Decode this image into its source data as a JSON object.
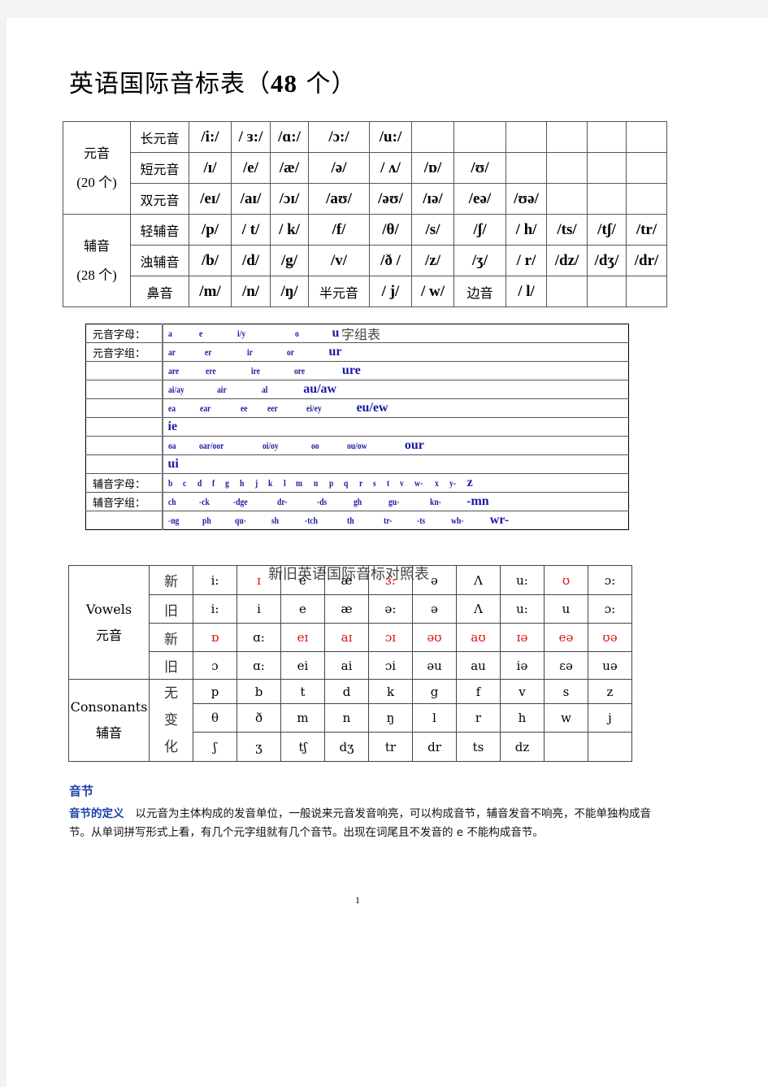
{
  "title": {
    "prefix": "英语国际音标表（",
    "count": "48",
    "suffix": " 个）"
  },
  "ipa_table": {
    "groups": [
      {
        "label": "元音",
        "count": "(20 个)"
      },
      {
        "label": "辅音",
        "count": "(28 个)"
      }
    ],
    "rows": [
      {
        "label": "长元音",
        "cells": [
          "/i:/",
          "/ ɜ:/",
          "/ɑ:/",
          "/ɔ:/",
          "/u:/",
          "",
          "",
          "",
          "",
          "",
          ""
        ]
      },
      {
        "label": "短元音",
        "cells": [
          "/ɪ/",
          "/e/",
          "/æ/",
          "/ə/",
          "/ ʌ/",
          "/ɒ/",
          "/ʊ/",
          "",
          "",
          "",
          ""
        ]
      },
      {
        "label": "双元音",
        "cells": [
          "/eɪ/",
          "/aɪ/",
          "/ɔɪ/",
          "/aʊ/",
          "/əʊ/",
          "/ɪə/",
          "/eə/",
          "/ʊə/",
          "",
          "",
          ""
        ]
      },
      {
        "label": "轻辅音",
        "cells": [
          "/p/",
          "/ t/",
          "/ k/",
          "/f/",
          "/θ/",
          "/s/",
          "/ʃ/",
          "/ h/",
          "/ts/",
          "/tʃ/",
          "/tr/"
        ]
      },
      {
        "label": "浊辅音",
        "cells": [
          "/b/",
          "/d/",
          "/g/",
          "/v/",
          "/ð /",
          "/z/",
          "/ʒ/",
          "/ r/",
          "/dz/",
          "/dʒ/",
          "/dr/"
        ]
      },
      {
        "label": "鼻音",
        "cells": [
          "/m/",
          "/n/",
          "/ŋ/",
          "半元音",
          "/ j/",
          "/ w/",
          "边音",
          "/ l/",
          "",
          "",
          ""
        ]
      }
    ]
  },
  "letter_table": {
    "caption": "字组表",
    "rows": [
      {
        "label": "元音字母：",
        "tokens": [
          "a",
          "e",
          "i/y",
          "o",
          "u"
        ]
      },
      {
        "label": "元音字组：",
        "tokens": [
          "ar",
          "er",
          "ir",
          "or",
          "ur"
        ]
      },
      {
        "label": "",
        "tokens": [
          "are",
          "ere",
          "ire",
          "ore",
          "ure"
        ]
      },
      {
        "label": "",
        "tokens": [
          "ai/ay",
          "air",
          "al",
          "au/aw"
        ]
      },
      {
        "label": "",
        "tokens": [
          "ea",
          "ear",
          "ee",
          "eer",
          "ei/ey",
          "eu/ew"
        ]
      },
      {
        "label": "",
        "tokens": [
          "ie"
        ]
      },
      {
        "label": "",
        "tokens": [
          "oa",
          "oar/oor",
          "oi/oy",
          "oo",
          "ou/ow",
          "our"
        ]
      },
      {
        "label": "",
        "tokens": [
          "ui"
        ]
      },
      {
        "label": "辅音字母：",
        "tokens": [
          "b",
          "c",
          "d",
          "f",
          "g",
          "h",
          "j",
          "k",
          "l",
          "m",
          "n",
          "p",
          "q",
          "r",
          "s",
          "t",
          "v",
          "w-",
          "x",
          "y-",
          "z"
        ]
      },
      {
        "label": "辅音字组：",
        "tokens": [
          "ch",
          "-ck",
          "-dge",
          "dr-",
          "-ds",
          "gh",
          "gu-",
          "kn-",
          "-mn"
        ]
      },
      {
        "label": "",
        "tokens": [
          "-ng",
          "ph",
          "qu-",
          "sh",
          "-tch",
          "th",
          "tr-",
          "-ts",
          "wh-",
          "wr-"
        ]
      }
    ]
  },
  "comparison_table": {
    "caption": "新旧英语国际音标对照表",
    "vowels": {
      "en": "Vowels",
      "zh": "元音"
    },
    "consonants": {
      "en": "Consonants",
      "zh": "辅音",
      "tag": [
        "无",
        "变",
        "化"
      ]
    },
    "vowel_rows": [
      {
        "tag": "新",
        "cells": [
          "i:",
          "ɪ",
          "e",
          "æ",
          "ɜ:",
          "ə",
          "Λ",
          "u:",
          "ʊ",
          "ɔ:"
        ],
        "red": [
          false,
          true,
          false,
          false,
          true,
          false,
          false,
          false,
          true,
          false
        ]
      },
      {
        "tag": "旧",
        "cells": [
          "i:",
          "i",
          "e",
          "æ",
          "ə:",
          "ə",
          "Λ",
          "u:",
          "u",
          "ɔ:"
        ],
        "red": [
          false,
          false,
          false,
          false,
          false,
          false,
          false,
          false,
          false,
          false
        ]
      },
      {
        "tag": "新",
        "cells": [
          "ɒ",
          "ɑ:",
          "eɪ",
          "aɪ",
          "ɔɪ",
          "əʊ",
          "aʊ",
          "ɪə",
          "eə",
          "ʊə"
        ],
        "red": [
          true,
          false,
          true,
          true,
          true,
          true,
          true,
          true,
          true,
          true
        ]
      },
      {
        "tag": "旧",
        "cells": [
          "ɔ",
          "ɑ:",
          "ei",
          "ai",
          "ɔi",
          "əu",
          "au",
          "iə",
          "ɛə",
          "uə"
        ],
        "red": [
          false,
          false,
          false,
          false,
          false,
          false,
          false,
          false,
          false,
          false
        ]
      }
    ],
    "consonant_rows": [
      [
        "p",
        "b",
        "t",
        "d",
        "k",
        "g",
        "f",
        "v",
        "s",
        "z"
      ],
      [
        "θ",
        "ð",
        "m",
        "n",
        "ŋ",
        "l",
        "r",
        "h",
        "w",
        "j"
      ],
      [
        "ʃ",
        "ʒ",
        "tʃ",
        "dʒ",
        "tr",
        "dr",
        "ts",
        "dz",
        "",
        ""
      ]
    ],
    "highlight_color": "#e01010"
  },
  "syllable": {
    "heading": "音节",
    "lead": "音节的定义",
    "text": "以元音为主体构成的发音单位，一般说来元音发音响亮，可以构成音节，辅音发音不响亮，不能单独构成音节。从单词拼写形式上看，有几个元字组就有几个音节。出现在词尾且不发音的 e 不能构成音节。"
  },
  "page_number": "1",
  "colors": {
    "letter_blue": "#1a1aa6",
    "heading_blue": "#1a3fa8"
  }
}
